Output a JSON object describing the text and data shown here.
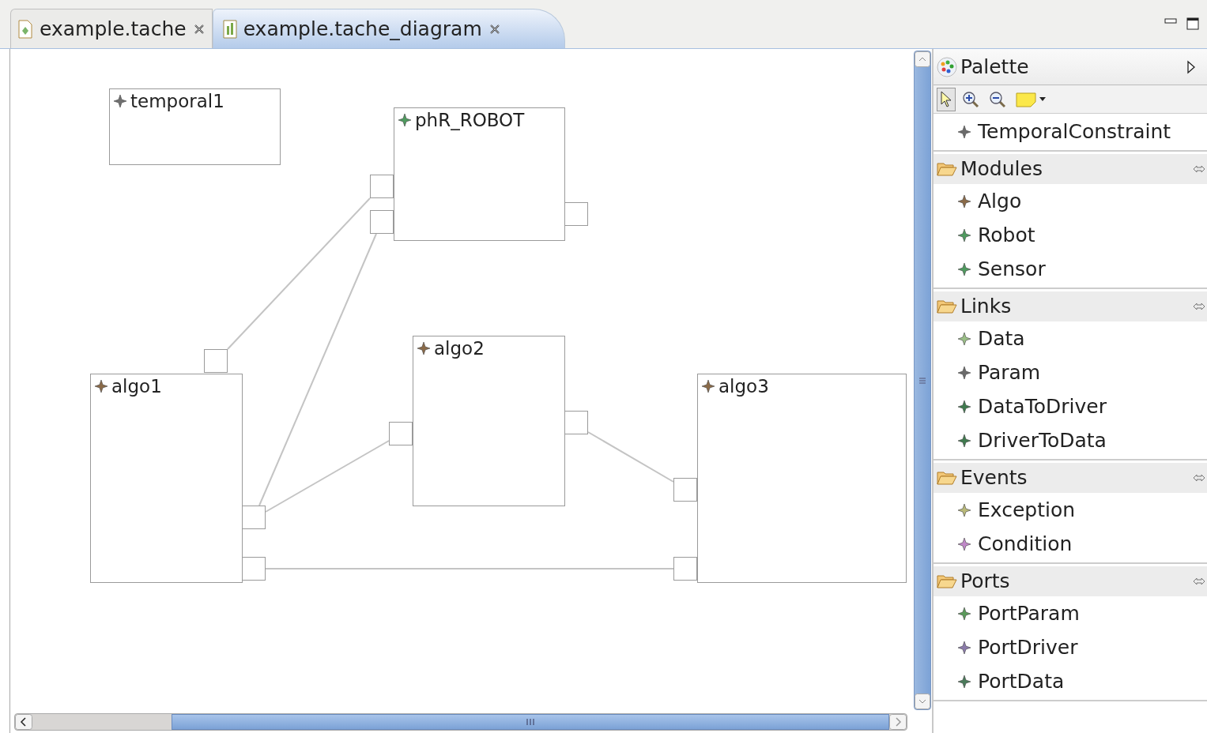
{
  "tabs": [
    {
      "label": "example.tache",
      "selected": false
    },
    {
      "label": "example.tache_diagram",
      "selected": true
    }
  ],
  "diagram": {
    "nodes": [
      {
        "label": "temporal1",
        "color": "#707070"
      },
      {
        "label": "phR_ROBOT",
        "color": "#4e9a5e"
      },
      {
        "label": "algo1",
        "color": "#8a6a48"
      },
      {
        "label": "algo2",
        "color": "#8a6a48"
      },
      {
        "label": "algo3",
        "color": "#8a6a48"
      }
    ]
  },
  "palette": {
    "title": "Palette",
    "tools": [
      {
        "kind": "select",
        "selected": true
      },
      {
        "kind": "zoom-in",
        "selected": false
      },
      {
        "kind": "zoom-out",
        "selected": false
      },
      {
        "kind": "note",
        "selected": false
      }
    ],
    "top_entries": [
      {
        "label": "TemporalConstraint",
        "color": "#6a6a6a"
      }
    ],
    "drawers": [
      {
        "label": "Modules",
        "expanded": true,
        "items": [
          {
            "label": "Algo",
            "color": "#8a6a48"
          },
          {
            "label": "Robot",
            "color": "#4e9a5e"
          },
          {
            "label": "Sensor",
            "color": "#4e9a5e"
          }
        ]
      },
      {
        "label": "Links",
        "expanded": true,
        "items": [
          {
            "label": "Data",
            "color": "#9abf86"
          },
          {
            "label": "Param",
            "color": "#6a6a6a"
          },
          {
            "label": "DataToDriver",
            "color": "#3f7a4e"
          },
          {
            "label": "DriverToData",
            "color": "#3f7a4e"
          }
        ]
      },
      {
        "label": "Events",
        "expanded": true,
        "items": [
          {
            "label": "Exception",
            "color": "#b8b878"
          },
          {
            "label": "Condition",
            "color": "#c088c8"
          }
        ]
      },
      {
        "label": "Ports",
        "expanded": true,
        "items": [
          {
            "label": "PortParam",
            "color": "#5a9a5a"
          },
          {
            "label": "PortDriver",
            "color": "#8a7aaa"
          },
          {
            "label": "PortData",
            "color": "#4a7a5a"
          }
        ]
      }
    ]
  }
}
